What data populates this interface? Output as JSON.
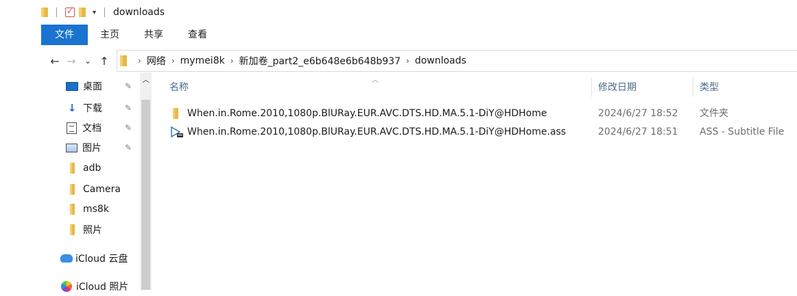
{
  "window": {
    "title": "downloads"
  },
  "ribbon": {
    "tabs": [
      "文件",
      "主页",
      "共享",
      "查看"
    ]
  },
  "nav": {
    "back": "←",
    "forward": "→",
    "recent": "⌄",
    "up": "↑",
    "breadcrumbs": [
      "网络",
      "mymei8k",
      "新加卷_part2_e6b648e6b648b937",
      "downloads"
    ]
  },
  "sidebar": {
    "items": [
      {
        "label": "桌面",
        "icon": "desktop-icon",
        "pinned": true
      },
      {
        "label": "下载",
        "icon": "download-icon",
        "pinned": true
      },
      {
        "label": "文档",
        "icon": "documents-icon",
        "pinned": true
      },
      {
        "label": "图片",
        "icon": "pictures-icon",
        "pinned": true
      },
      {
        "label": "adb",
        "icon": "folder-icon",
        "pinned": false
      },
      {
        "label": "Camera",
        "icon": "folder-icon",
        "pinned": false
      },
      {
        "label": "ms8k",
        "icon": "folder-icon",
        "pinned": false
      },
      {
        "label": "照片",
        "icon": "folder-icon",
        "pinned": false
      },
      {
        "label": "iCloud 云盘",
        "icon": "icloud-drive-icon",
        "pinned": false
      },
      {
        "label": "iCloud 照片",
        "icon": "icloud-photos-icon",
        "pinned": false
      }
    ]
  },
  "columns": {
    "name": "名称",
    "date": "修改日期",
    "type": "类型"
  },
  "files": [
    {
      "name": "When.in.Rome.2010,1080p.BlURay.EUR.AVC.DTS.HD.MA.5.1-DiY@HDHome",
      "date": "2024/6/27 18:52",
      "type": "文件夹",
      "icon": "folder-icon"
    },
    {
      "name": "When.in.Rome.2010,1080p.BlURay.EUR.AVC.DTS.HD.MA.5.1-DiY@HDHome.ass",
      "date": "2024/6/27 18:51",
      "type": "ASS - Subtitle File",
      "icon": "subtitle-file-icon"
    }
  ],
  "colors": {
    "file_tab": "#1973d1",
    "folder": "#e8b84a",
    "header_text": "#4d6b8a"
  }
}
